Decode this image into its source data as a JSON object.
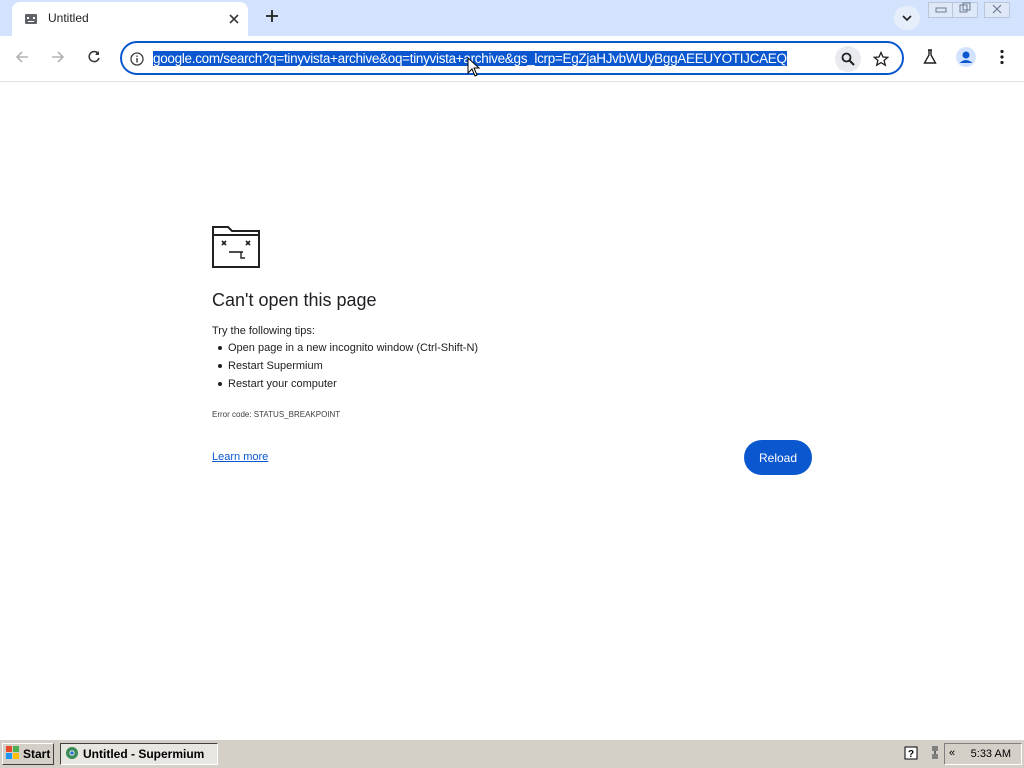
{
  "browser": {
    "tab": {
      "title": "Untitled"
    },
    "omnibox": {
      "url": "google.com/search?q=tinyvista+archive&oq=tinyvista+archive&gs_lcrp=EgZjaHJvbWUyBggAEEUYOTIJCAEQ"
    }
  },
  "error": {
    "title": "Can't open this page",
    "tips_label": "Try the following tips:",
    "tips": [
      "Open page in a new incognito window (Ctrl-Shift-N)",
      "Restart Supermium",
      "Restart your computer"
    ],
    "code": "Error code: STATUS_BREAKPOINT",
    "learn_more": "Learn more",
    "reload": "Reload"
  },
  "taskbar": {
    "start": "Start",
    "task": "Untitled - Supermium",
    "clock": "5:33 AM",
    "tray_chevron": "«"
  },
  "colors": {
    "accent": "#0b57d0",
    "tabstrip_bg": "#d3e3fd",
    "taskbar_bg": "#d4d0c8"
  },
  "icons": [
    "page-icon",
    "close-icon",
    "plus-icon",
    "chevron-down-icon",
    "minimize-icon",
    "restore-icon",
    "close-window-icon",
    "back-arrow-icon",
    "forward-arrow-icon",
    "reload-icon",
    "info-icon",
    "search-icon",
    "star-icon",
    "flask-icon",
    "profile-icon",
    "more-vert-icon",
    "sad-folder-icon",
    "windows-flag-icon",
    "browser-icon",
    "help-icon",
    "network-icon"
  ]
}
